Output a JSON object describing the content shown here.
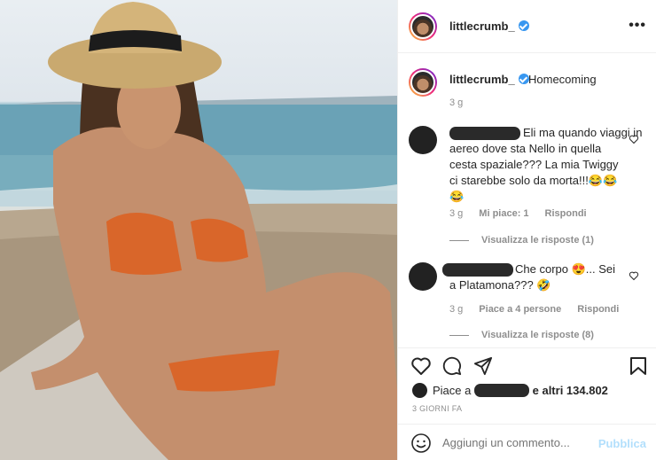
{
  "post": {
    "image_alt": "Photo of a woman in an orange bikini and straw hat sitting on a beach"
  },
  "header": {
    "username": "littlecrumb_",
    "more_label": "•••"
  },
  "caption": {
    "username": "littlecrumb_",
    "text": "Homecoming",
    "time": "3 g"
  },
  "comments": [
    {
      "line1": "Eli ma quando viaggi in",
      "line2": "aereo dove sta Nello in quella",
      "line3": "cesta spaziale??? La mia Twiggy",
      "line4": "ci starebbe solo da morta!!!😂😂",
      "line5": "😂",
      "time": "3 g",
      "likes": "Mi piace: 1",
      "reply": "Rispondi",
      "view_replies": "Visualizza le risposte (1)"
    },
    {
      "line1": "Che corpo 😍... Sei",
      "line2": "a Platamona??? 🤣",
      "time": "3 g",
      "likes": "Piace a 4 persone",
      "reply": "Rispondi",
      "view_replies": "Visualizza le risposte (8)"
    }
  ],
  "likes": {
    "prefix": "Piace a",
    "suffix": "e altri 134.802"
  },
  "posted_ago": "3 GIORNI FA",
  "comment_input": {
    "placeholder": "Aggiungi un commento..."
  },
  "publish_label": "Pubblica",
  "colors": {
    "verified": "#3897f0",
    "publish_disabled": "#b2dffc",
    "muted_text": "#8e8e8e"
  }
}
